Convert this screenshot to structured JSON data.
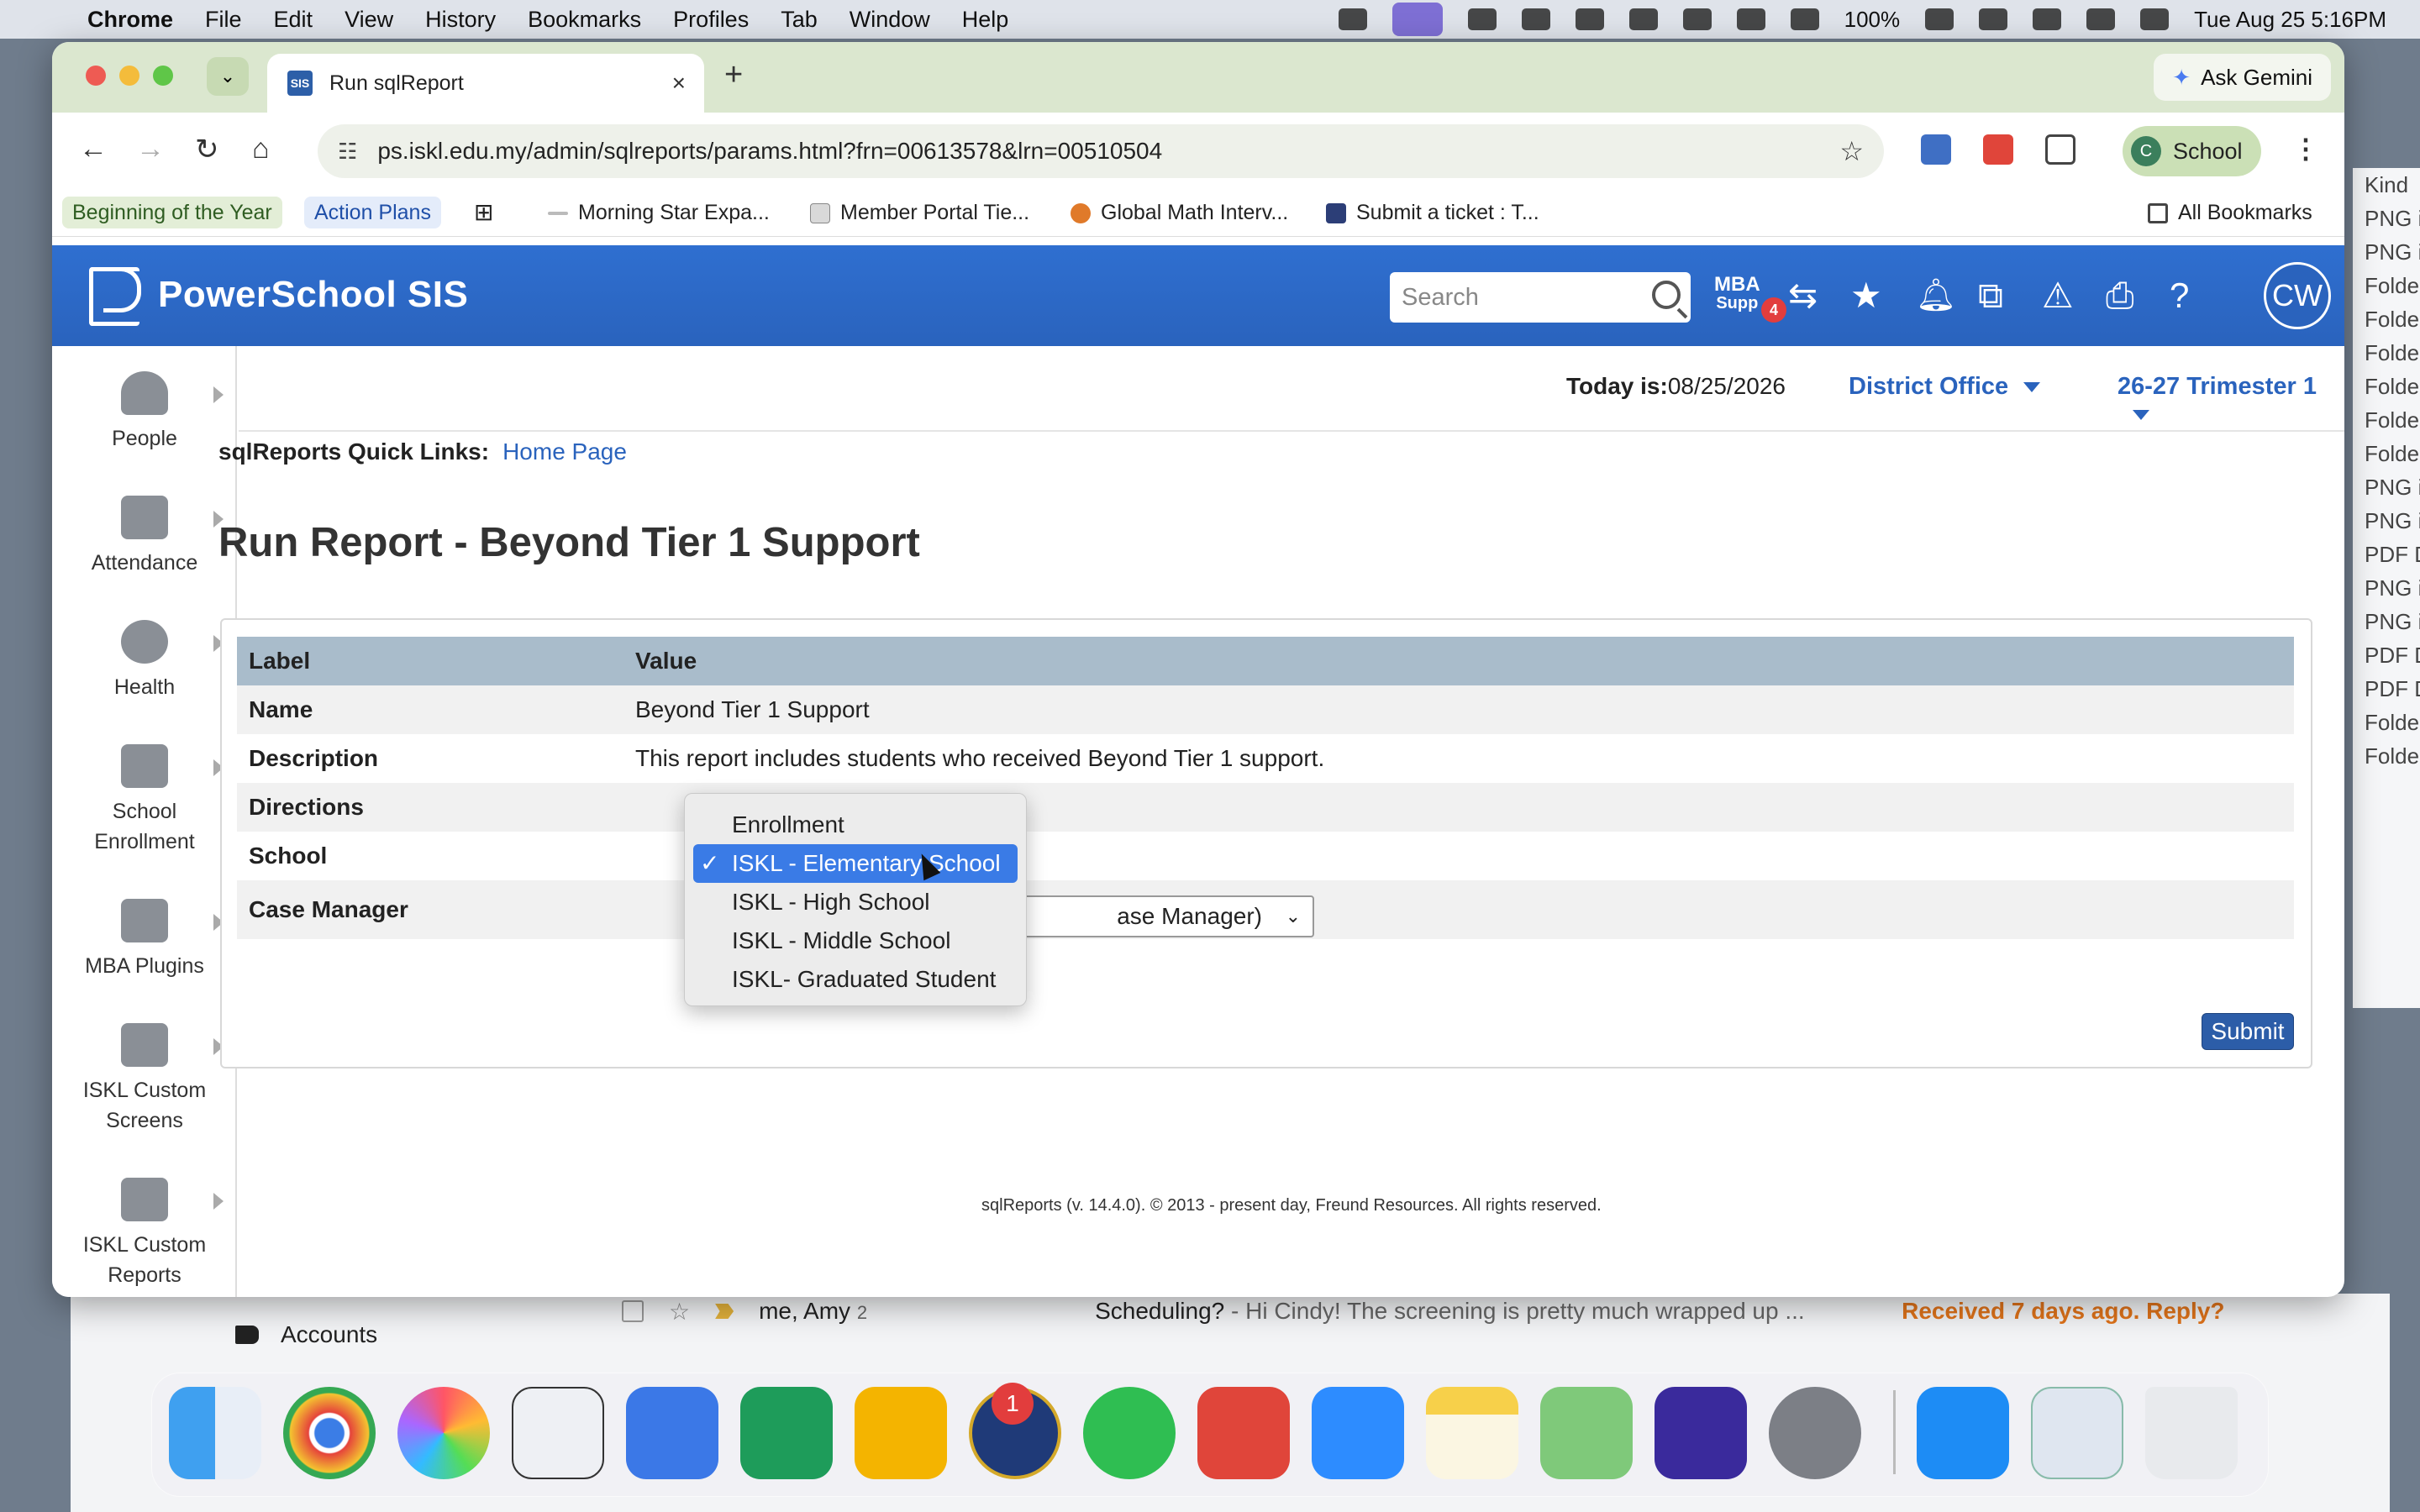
{
  "menubar": {
    "app": "Chrome",
    "items": [
      "File",
      "Edit",
      "View",
      "History",
      "Bookmarks",
      "Profiles",
      "Tab",
      "Window",
      "Help"
    ],
    "battery": "100%",
    "datetime": "Tue Aug 25  5:16PM"
  },
  "browser": {
    "tab_title": "Run sqlReport",
    "tab_favicon": "SIS",
    "close_glyph": "×",
    "newtab_glyph": "+",
    "ask_gemini": "Ask Gemini",
    "url": "ps.iskl.edu.my/admin/sqlreports/params.html?frn=00613578&lrn=00510504",
    "profile_initial": "C",
    "profile_label": "School",
    "bookmarks": [
      "Beginning of the Year",
      "Action Plans",
      "Morning Star Expa...",
      "Member Portal Tie...",
      "Global Math Interv...",
      "Submit a ticket : T..."
    ],
    "all_bookmarks": "All Bookmarks"
  },
  "ps_header": {
    "title": "PowerSchool SIS",
    "search_placeholder": "Search",
    "mba_label_1": "MBA",
    "mba_label_2": "Supp",
    "mba_badge": "4",
    "avatar": "CW"
  },
  "leftnav": {
    "items": [
      {
        "label": "People"
      },
      {
        "label": "Attendance"
      },
      {
        "label": "Health"
      },
      {
        "label": "School Enrollment"
      },
      {
        "label": "MBA Plugins"
      },
      {
        "label": "ISKL Custom Screens"
      },
      {
        "label": "ISKL Custom Reports"
      }
    ]
  },
  "topinfo": {
    "today_label": "Today is:",
    "today_value": "08/25/2026",
    "district": "District Office",
    "term": "26-27 Trimester 1"
  },
  "content": {
    "quick_links_label": "sqlReports Quick Links:",
    "home_page": "Home Page",
    "page_title": "Run Report - Beyond Tier 1 Support",
    "table": {
      "col_label": "Label",
      "col_value": "Value",
      "name_label": "Name",
      "name_value": "Beyond Tier 1 Support",
      "desc_label": "Description",
      "desc_value": "This report includes students who received Beyond Tier 1 support.",
      "directions_label": "Directions",
      "school_label": "School",
      "case_manager_label": "Case Manager",
      "case_manager_value": "ase Manager)"
    },
    "school_options": [
      "Enrollment",
      "ISKL - Elementary School",
      "ISKL - High School",
      "ISKL - Middle School",
      "ISKL- Graduated Student"
    ],
    "school_selected_index": 1,
    "submit": "Submit",
    "footer": "sqlReports (v. 14.4.0). © 2013 - present day, Freund Resources. All rights reserved."
  },
  "background": {
    "accounts": "Accounts",
    "mail_from": "me, Amy",
    "mail_count": "2",
    "mail_subject": "Scheduling?",
    "mail_snippet": " - Hi Cindy! The screening is pretty much wrapped up ...",
    "mail_nudge": "Received 7 days ago. Reply?",
    "finder_items": [
      "Kind",
      "PNG i",
      "PNG i",
      "Folde",
      "Folde",
      "Folde",
      "Folde",
      "Folde",
      "Folde",
      "PNG i",
      "PNG i",
      "PDF D",
      "PNG i",
      "PNG i",
      "PDF D",
      "PDF D",
      "Folde",
      "Folde"
    ]
  },
  "dock": {
    "whatsapp_badge": "1"
  }
}
